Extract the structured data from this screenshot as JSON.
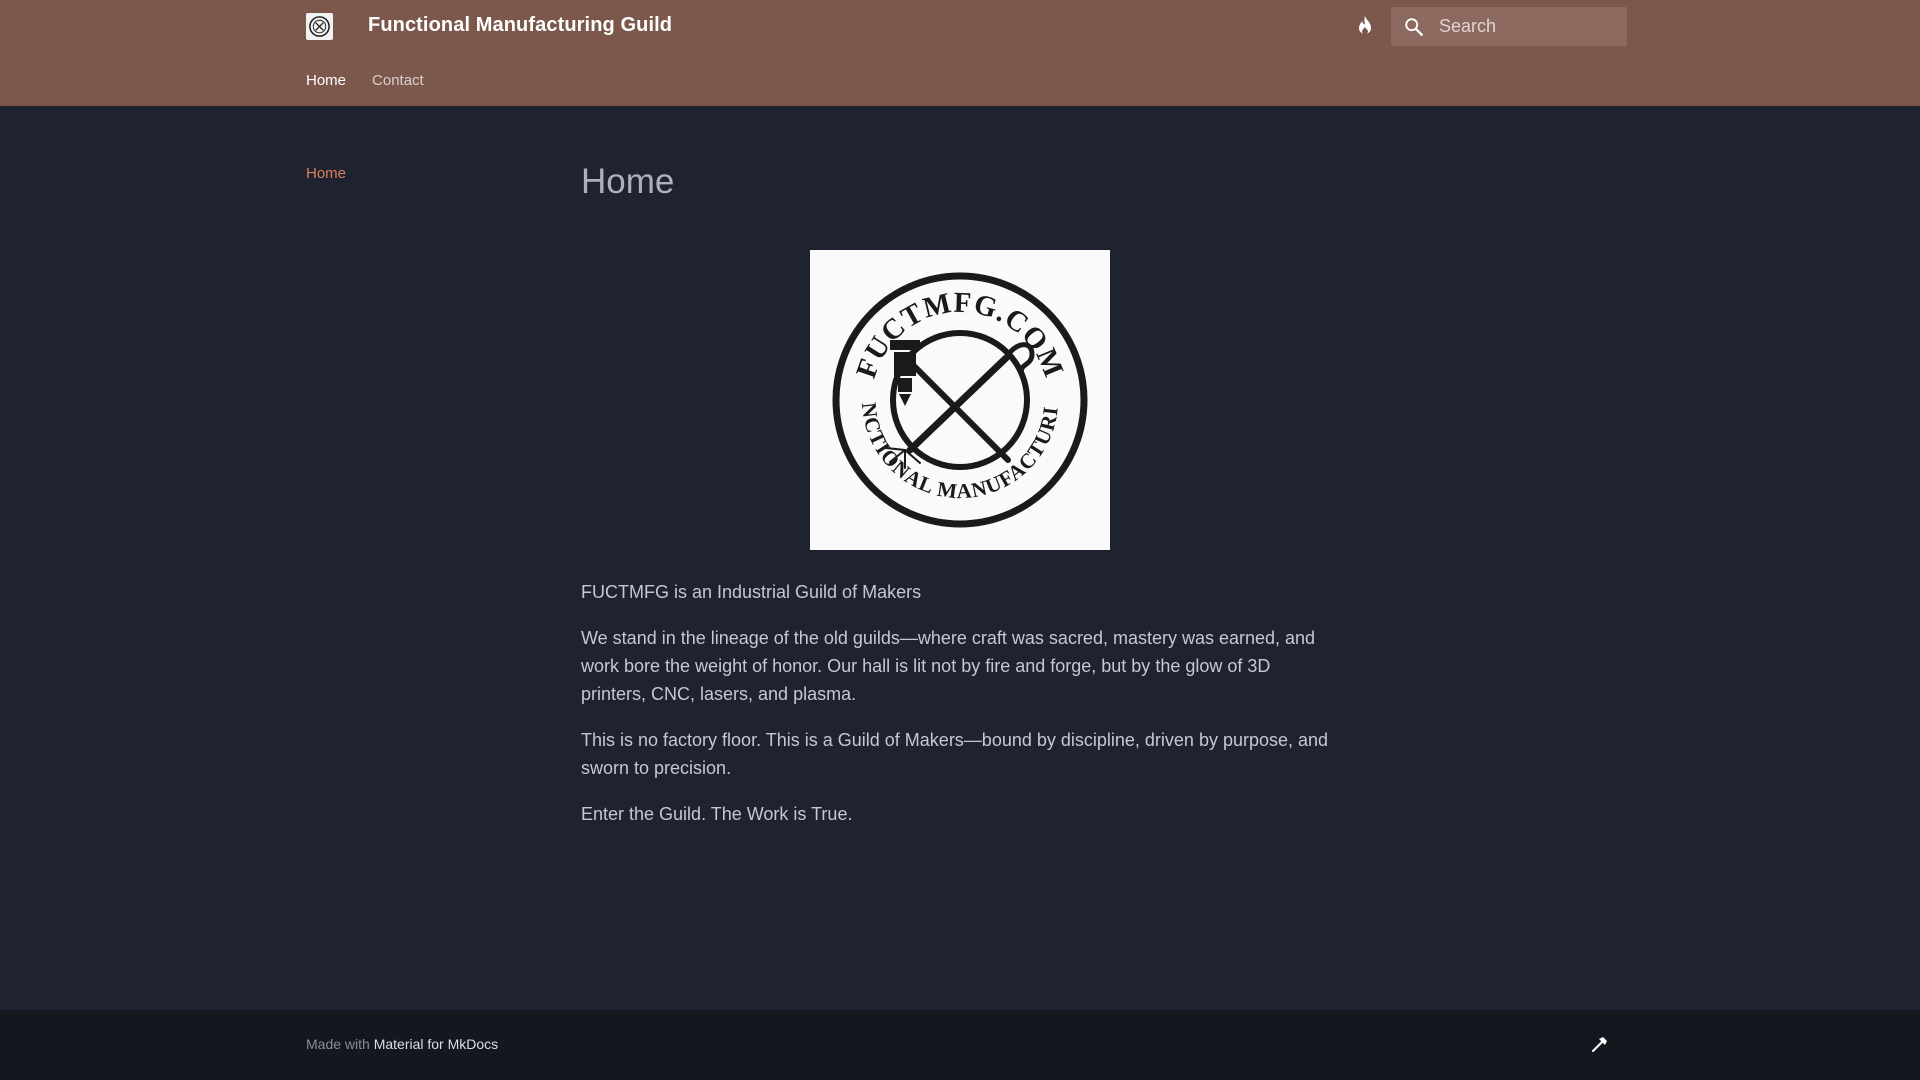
{
  "header": {
    "site_title": "Functional Manufacturing Guild",
    "search_placeholder": "Search",
    "logo_icon": "guild-logo-icon",
    "theme_icon": "flame-icon",
    "search_icon": "search-icon"
  },
  "tabs": [
    {
      "label": "Home",
      "active": true
    },
    {
      "label": "Contact",
      "active": false
    }
  ],
  "sidebar": {
    "items": [
      {
        "label": "Home",
        "active": true
      }
    ]
  },
  "main": {
    "title": "Home",
    "logo_text_top": "FUCTMFG.COM",
    "logo_text_bottom": "FUNCTIONAL MANUFACTURING",
    "paragraphs": [
      "FUCTMFG is an Industrial Guild of Makers",
      "We stand in the lineage of the old guilds—where craft was sacred, mastery was earned, and work bore the weight of honor. Our hall is lit not by fire and forge, but by the glow of 3D printers, CNC, lasers, and plasma.",
      "This is no factory floor. This is a Guild of Makers—bound by discipline, driven by purpose, and sworn to precision.",
      "Enter the Guild. The Work is True."
    ]
  },
  "footer": {
    "made_with": "Made with",
    "link_label": "Material for MkDocs",
    "icon": "hammer-icon"
  },
  "colors": {
    "header_bg": "#7c574b",
    "page_bg": "#1f2230",
    "footer_bg": "#15171f",
    "accent": "#d8805a"
  }
}
